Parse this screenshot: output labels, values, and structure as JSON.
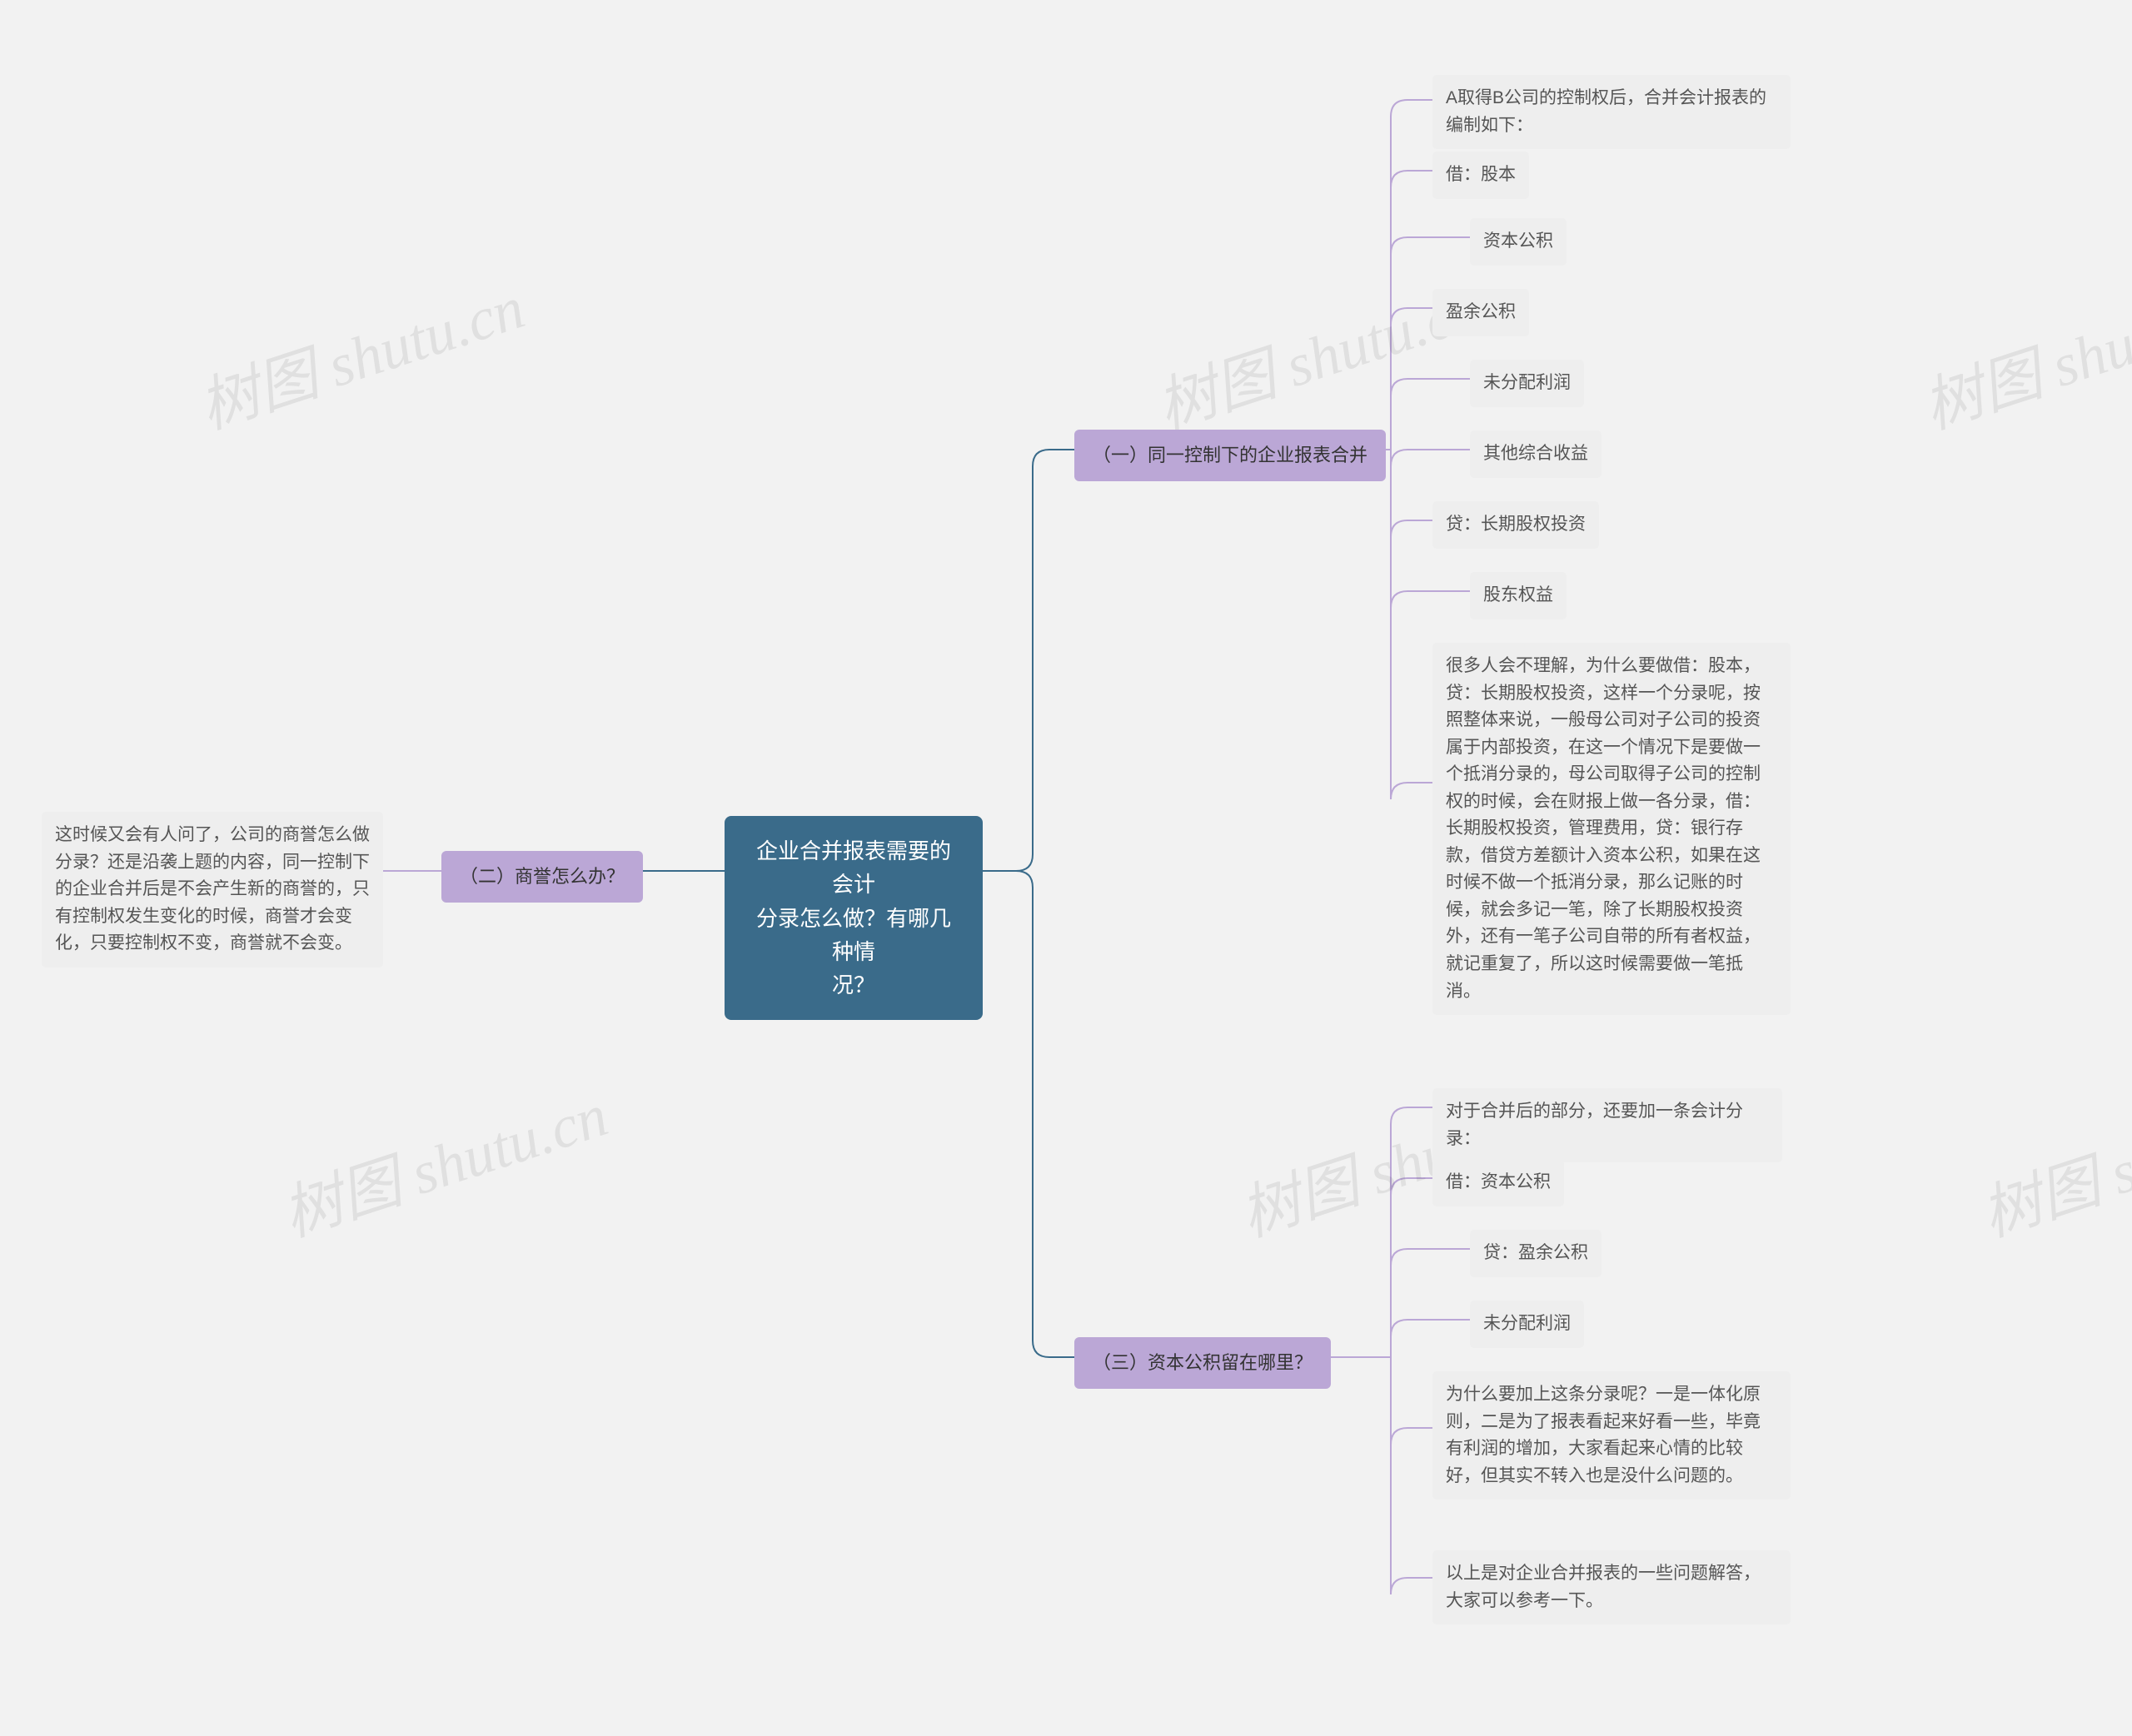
{
  "watermark": "树图 shutu.cn",
  "root": {
    "title_line1": "企业合并报表需要的会计",
    "title_line2": "分录怎么做？有哪几种情",
    "title_line3": "况？"
  },
  "branch_left": {
    "label": "（二）商誉怎么办？",
    "leaf": "这时候又会有人问了，公司的商誉怎么做分录？还是沿袭上题的内容，同一控制下的企业合并后是不会产生新的商誉的，只有控制权发生变化的时候，商誉才会变化，只要控制权不变，商誉就不会变。"
  },
  "branch_r1": {
    "label": "（一）同一控制下的企业报表合并",
    "leaves": [
      "A取得B公司的控制权后，合并会计报表的编制如下：",
      "借：股本",
      "资本公积",
      "盈余公积",
      "未分配利润",
      "其他综合收益",
      "贷：长期股权投资",
      "股东权益",
      "很多人会不理解，为什么要做借：股本，贷：长期股权投资，这样一个分录呢，按照整体来说，一般母公司对子公司的投资属于内部投资，在这一个情况下是要做一个抵消分录的，母公司取得子公司的控制权的时候，会在财报上做一各分录，借：长期股权投资，管理费用，贷：银行存款，借贷方差额计入资本公积，如果在这时候不做一个抵消分录，那么记账的时候，就会多记一笔，除了长期股权投资外，还有一笔子公司自带的所有者权益，就记重复了，所以这时候需要做一笔抵消。"
    ]
  },
  "branch_r2": {
    "label": "（三）资本公积留在哪里？",
    "leaves": [
      "对于合并后的部分，还要加一条会计分录：",
      "借：资本公积",
      "贷：盈余公积",
      "未分配利润",
      "为什么要加上这条分录呢？一是一体化原则，二是为了报表看起来好看一些，毕竟有利润的增加，大家看起来心情的比较好，但其实不转入也是没什么问题的。",
      "以上是对企业合并报表的一些问题解答，大家可以参考一下。"
    ]
  }
}
